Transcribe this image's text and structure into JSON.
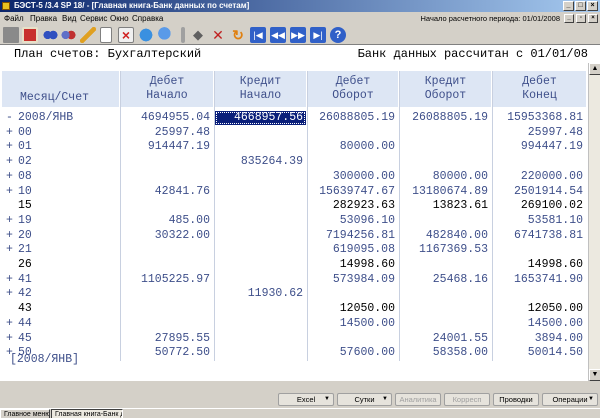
{
  "window": {
    "title": "БЭСТ-5 /3.4 SP 18/ - [Главная книга-Банк данных по счетам]"
  },
  "menu": {
    "items": [
      "Файл",
      "Правка",
      "Вид",
      "Сервис",
      "Окно",
      "Справка"
    ],
    "period": "Начало расчетного периода: 01/01/2008"
  },
  "toolbar": {
    "icons": [
      "book-icon",
      "calendar-icon",
      "glasses-icon",
      "glasses-alt-icon",
      "pencil-icon",
      "blank-page-icon",
      "delete-icon",
      "globe-icon",
      "search-globe-icon",
      "diamond-icon",
      "remove-icon",
      "refresh-icon",
      "first-icon",
      "prev-icon",
      "next-icon",
      "last-icon",
      "help-icon"
    ]
  },
  "header": {
    "plan": "План счетов: Бухгалтерский",
    "bank": "Банк данных рассчитан с 01/01/08"
  },
  "grid": {
    "columns": [
      {
        "line1": "",
        "line2": "Месяц/Счет"
      },
      {
        "line1": "Дебет",
        "line2": "Начало"
      },
      {
        "line1": "Кредит",
        "line2": "Начало"
      },
      {
        "line1": "Дебет",
        "line2": "Оборот"
      },
      {
        "line1": "Кредит",
        "line2": "Оборот"
      },
      {
        "line1": "Дебет",
        "line2": "Конец"
      }
    ],
    "rows": [
      {
        "sign": "-",
        "acc": "2008/ЯНВ",
        "dn": "4694955.04",
        "kn": "4668957.56",
        "do": "26088805.19",
        "ko": "26088805.19",
        "dk": "15953368.81",
        "style": "alt"
      },
      {
        "sign": "+",
        "acc": "00",
        "dn": "25997.48",
        "kn": "",
        "do": "",
        "ko": "",
        "dk": "25997.48",
        "style": "alt"
      },
      {
        "sign": "+",
        "acc": "01",
        "dn": "914447.19",
        "kn": "",
        "do": "80000.00",
        "ko": "",
        "dk": "994447.19",
        "style": "alt"
      },
      {
        "sign": "+",
        "acc": "02",
        "dn": "",
        "kn": "835264.39",
        "do": "",
        "ko": "",
        "dk": "",
        "style": "alt"
      },
      {
        "sign": "+",
        "acc": "08",
        "dn": "",
        "kn": "",
        "do": "300000.00",
        "ko": "80000.00",
        "dk": "220000.00",
        "style": "alt"
      },
      {
        "sign": "+",
        "acc": "10",
        "dn": "42841.76",
        "kn": "",
        "do": "15639747.67",
        "ko": "13180674.89",
        "dk": "2501914.54",
        "style": "alt"
      },
      {
        "sign": "",
        "acc": "15",
        "dn": "",
        "kn": "",
        "do": "282923.63",
        "ko": "13823.61",
        "dk": "269100.02",
        "style": "plain"
      },
      {
        "sign": "+",
        "acc": "19",
        "dn": "485.00",
        "kn": "",
        "do": "53096.10",
        "ko": "",
        "dk": "53581.10",
        "style": "alt"
      },
      {
        "sign": "+",
        "acc": "20",
        "dn": "30322.00",
        "kn": "",
        "do": "7194256.81",
        "ko": "482840.00",
        "dk": "6741738.81",
        "style": "alt"
      },
      {
        "sign": "+",
        "acc": "21",
        "dn": "",
        "kn": "",
        "do": "619095.08",
        "ko": "1167369.53",
        "dk": "",
        "style": "alt"
      },
      {
        "sign": "",
        "acc": "26",
        "dn": "",
        "kn": "",
        "do": "14998.60",
        "ko": "",
        "dk": "14998.60",
        "style": "plain"
      },
      {
        "sign": "+",
        "acc": "41",
        "dn": "1105225.97",
        "kn": "",
        "do": "573984.09",
        "ko": "25468.16",
        "dk": "1653741.90",
        "style": "alt"
      },
      {
        "sign": "+",
        "acc": "42",
        "dn": "",
        "kn": "11930.62",
        "do": "",
        "ko": "",
        "dk": "",
        "style": "alt"
      },
      {
        "sign": "",
        "acc": "43",
        "dn": "",
        "kn": "",
        "do": "12050.00",
        "ko": "",
        "dk": "12050.00",
        "style": "plain"
      },
      {
        "sign": "+",
        "acc": "44",
        "dn": "",
        "kn": "",
        "do": "14500.00",
        "ko": "",
        "dk": "14500.00",
        "style": "alt"
      },
      {
        "sign": "+",
        "acc": "45",
        "dn": "27895.55",
        "kn": "",
        "do": "",
        "ko": "24001.55",
        "dk": "3894.00",
        "style": "alt"
      },
      {
        "sign": "+",
        "acc": "50",
        "dn": "50772.50",
        "kn": "",
        "do": "57600.00",
        "ko": "58358.00",
        "dk": "50014.50",
        "style": "alt"
      }
    ],
    "footer": "[2008/ЯНВ]"
  },
  "buttons": {
    "excel": "Excel",
    "sutki": "Сутки",
    "analytics": "Аналитика",
    "korresp": "Корресп",
    "provodki": "Проводки",
    "operations": "Операции"
  },
  "taskbar": [
    "Главное меню",
    "Главная книга-Банк д"
  ]
}
